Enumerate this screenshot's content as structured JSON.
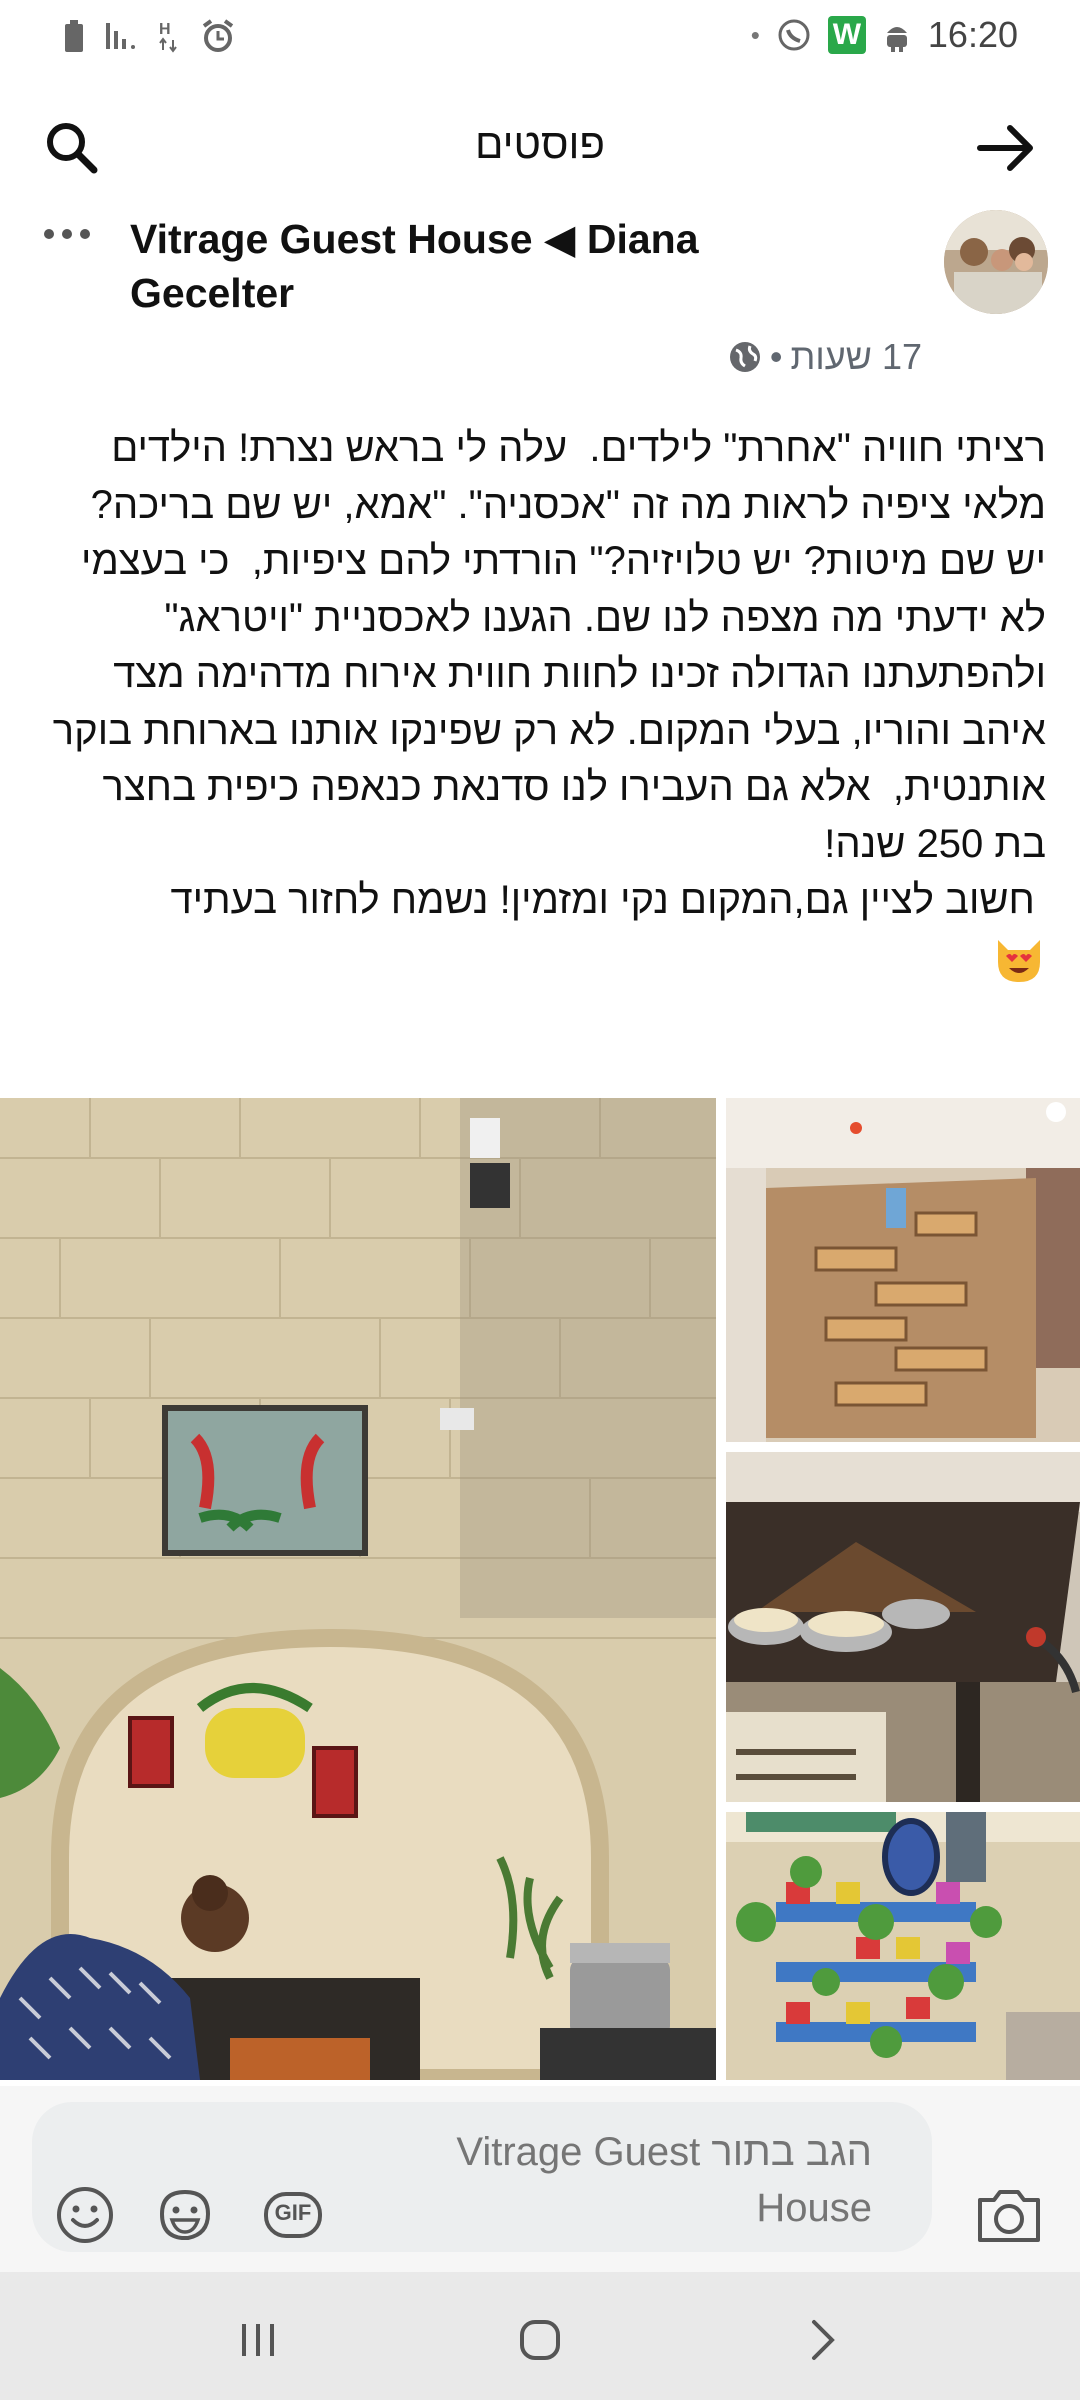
{
  "status_bar": {
    "time": "16:20",
    "app_badge": "W"
  },
  "header": {
    "title": "פוסטים"
  },
  "post": {
    "author": "Vitrage Guest House ◀ Diana Gecelter",
    "timestamp": "17 שעות",
    "separator": "•",
    "body": "רציתי חוויה \"אחרת\" לילדים.  עלה לי בראש נצרת! הילדים מלאי ציפיה לראות מה זה \"אכסניה\". \"אמא, יש שם בריכה? יש שם מיטות? יש טלויזיה?\" הורדתי להם ציפיות,  כי בעצמי לא ידעתי מה מצפה לנו שם. הגענו לאכסניית \"ויטראג\" ולהפתעתנו הגדולה זכינו לחוות חווית אירוח מדהימה מצד איהב והוריו, בעלי המקום. לא רק שפינקו אותנו בארוחת בוקר אותנטית,  אלא גם העבירו לנו סדנאת כנאפה כיפית בחצר בת 250 שנה!\n חשוב לציין גם,המקום נקי ומזמין! נשמח לחזור בעתיד"
  },
  "composer": {
    "placeholder": "הגב בתור Vitrage Guest House",
    "gif_label": "GIF"
  },
  "icons": {
    "search": "search-icon",
    "back": "arrow-right-icon",
    "more": "more-dots-icon",
    "globe": "globe-icon",
    "emoji": "smiley-icon",
    "sticker": "sticker-icon",
    "gif": "gif-icon",
    "camera": "camera-icon",
    "nav_recent": "recent-apps-icon",
    "nav_home": "home-icon",
    "nav_back": "nav-back-icon"
  },
  "colors": {
    "text": "#1c1e21",
    "meta": "#606770",
    "badge_green": "#2aa84a",
    "navbar": "#e9e9e9"
  }
}
